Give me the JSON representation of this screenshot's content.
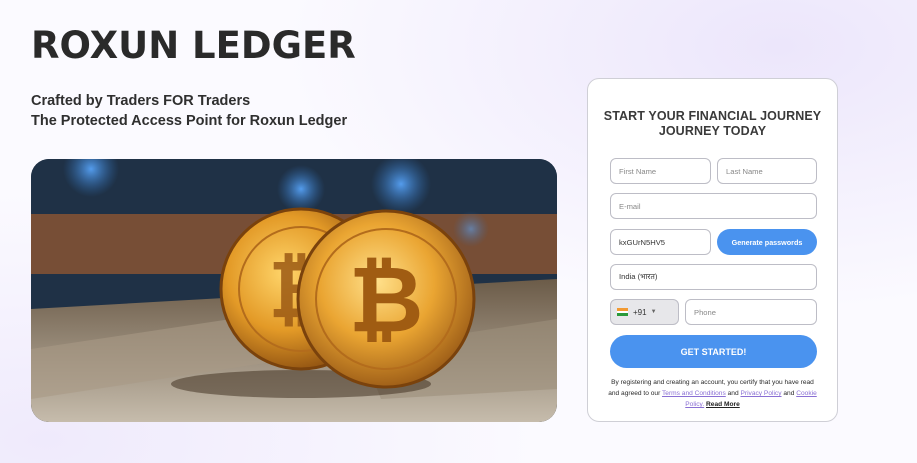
{
  "brand": {
    "name": "ROXUN LEDGER"
  },
  "tagline": {
    "line1": "Crafted by Traders FOR Traders",
    "line2": "The Protected Access Point for Roxun Ledger"
  },
  "hero": {
    "description_icon": "bitcoin-coins-image"
  },
  "form": {
    "title_line1": "START YOUR FINANCIAL JOURNEY",
    "title_line2": "JOURNEY TODAY",
    "first_name_placeholder": "First Name",
    "last_name_placeholder": "Last Name",
    "email_placeholder": "E-mail",
    "password_value": "kxGUrN5HV5",
    "generate_label": "Generate passwords",
    "country_value": "India (भारत)",
    "phone_code": "+91",
    "phone_placeholder": "Phone",
    "submit_label": "GET STARTED!",
    "legal": {
      "text1": "By registering and creating an account, you certify that you have read and agreed to our",
      "terms": "Terms and Conditions",
      "and1": "and",
      "privacy": "Privacy Policy",
      "and2": "and",
      "cookie": "Cookie Policy.",
      "read_more": "Read More"
    }
  },
  "colors": {
    "accent": "#4a93ef",
    "link": "#8a6fd4",
    "text": "#2a2a2a"
  }
}
